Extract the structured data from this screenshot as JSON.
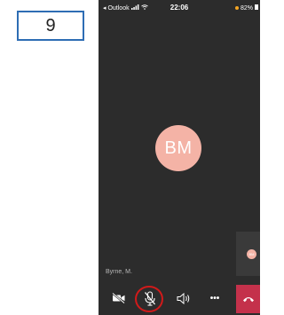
{
  "step": {
    "number": "9"
  },
  "status_bar": {
    "back_app": "◂ Outlook",
    "time": "22:06",
    "battery": "82%"
  },
  "call": {
    "avatar_initials": "BM",
    "caller_name": "Byrne, M.",
    "self_initials": "BM"
  },
  "controls": {
    "video": "video-off-icon",
    "mute": "mic-muted-icon",
    "speaker": "speaker-icon",
    "more": "•••",
    "end": "end-call-icon"
  },
  "colors": {
    "phone_bg": "#2c2c2c",
    "avatar_bg": "#f4b3a6",
    "end_call": "#c4314b",
    "highlight": "#d11a1a",
    "step_border": "#2e6db4",
    "battery_dot": "#f5a623"
  }
}
